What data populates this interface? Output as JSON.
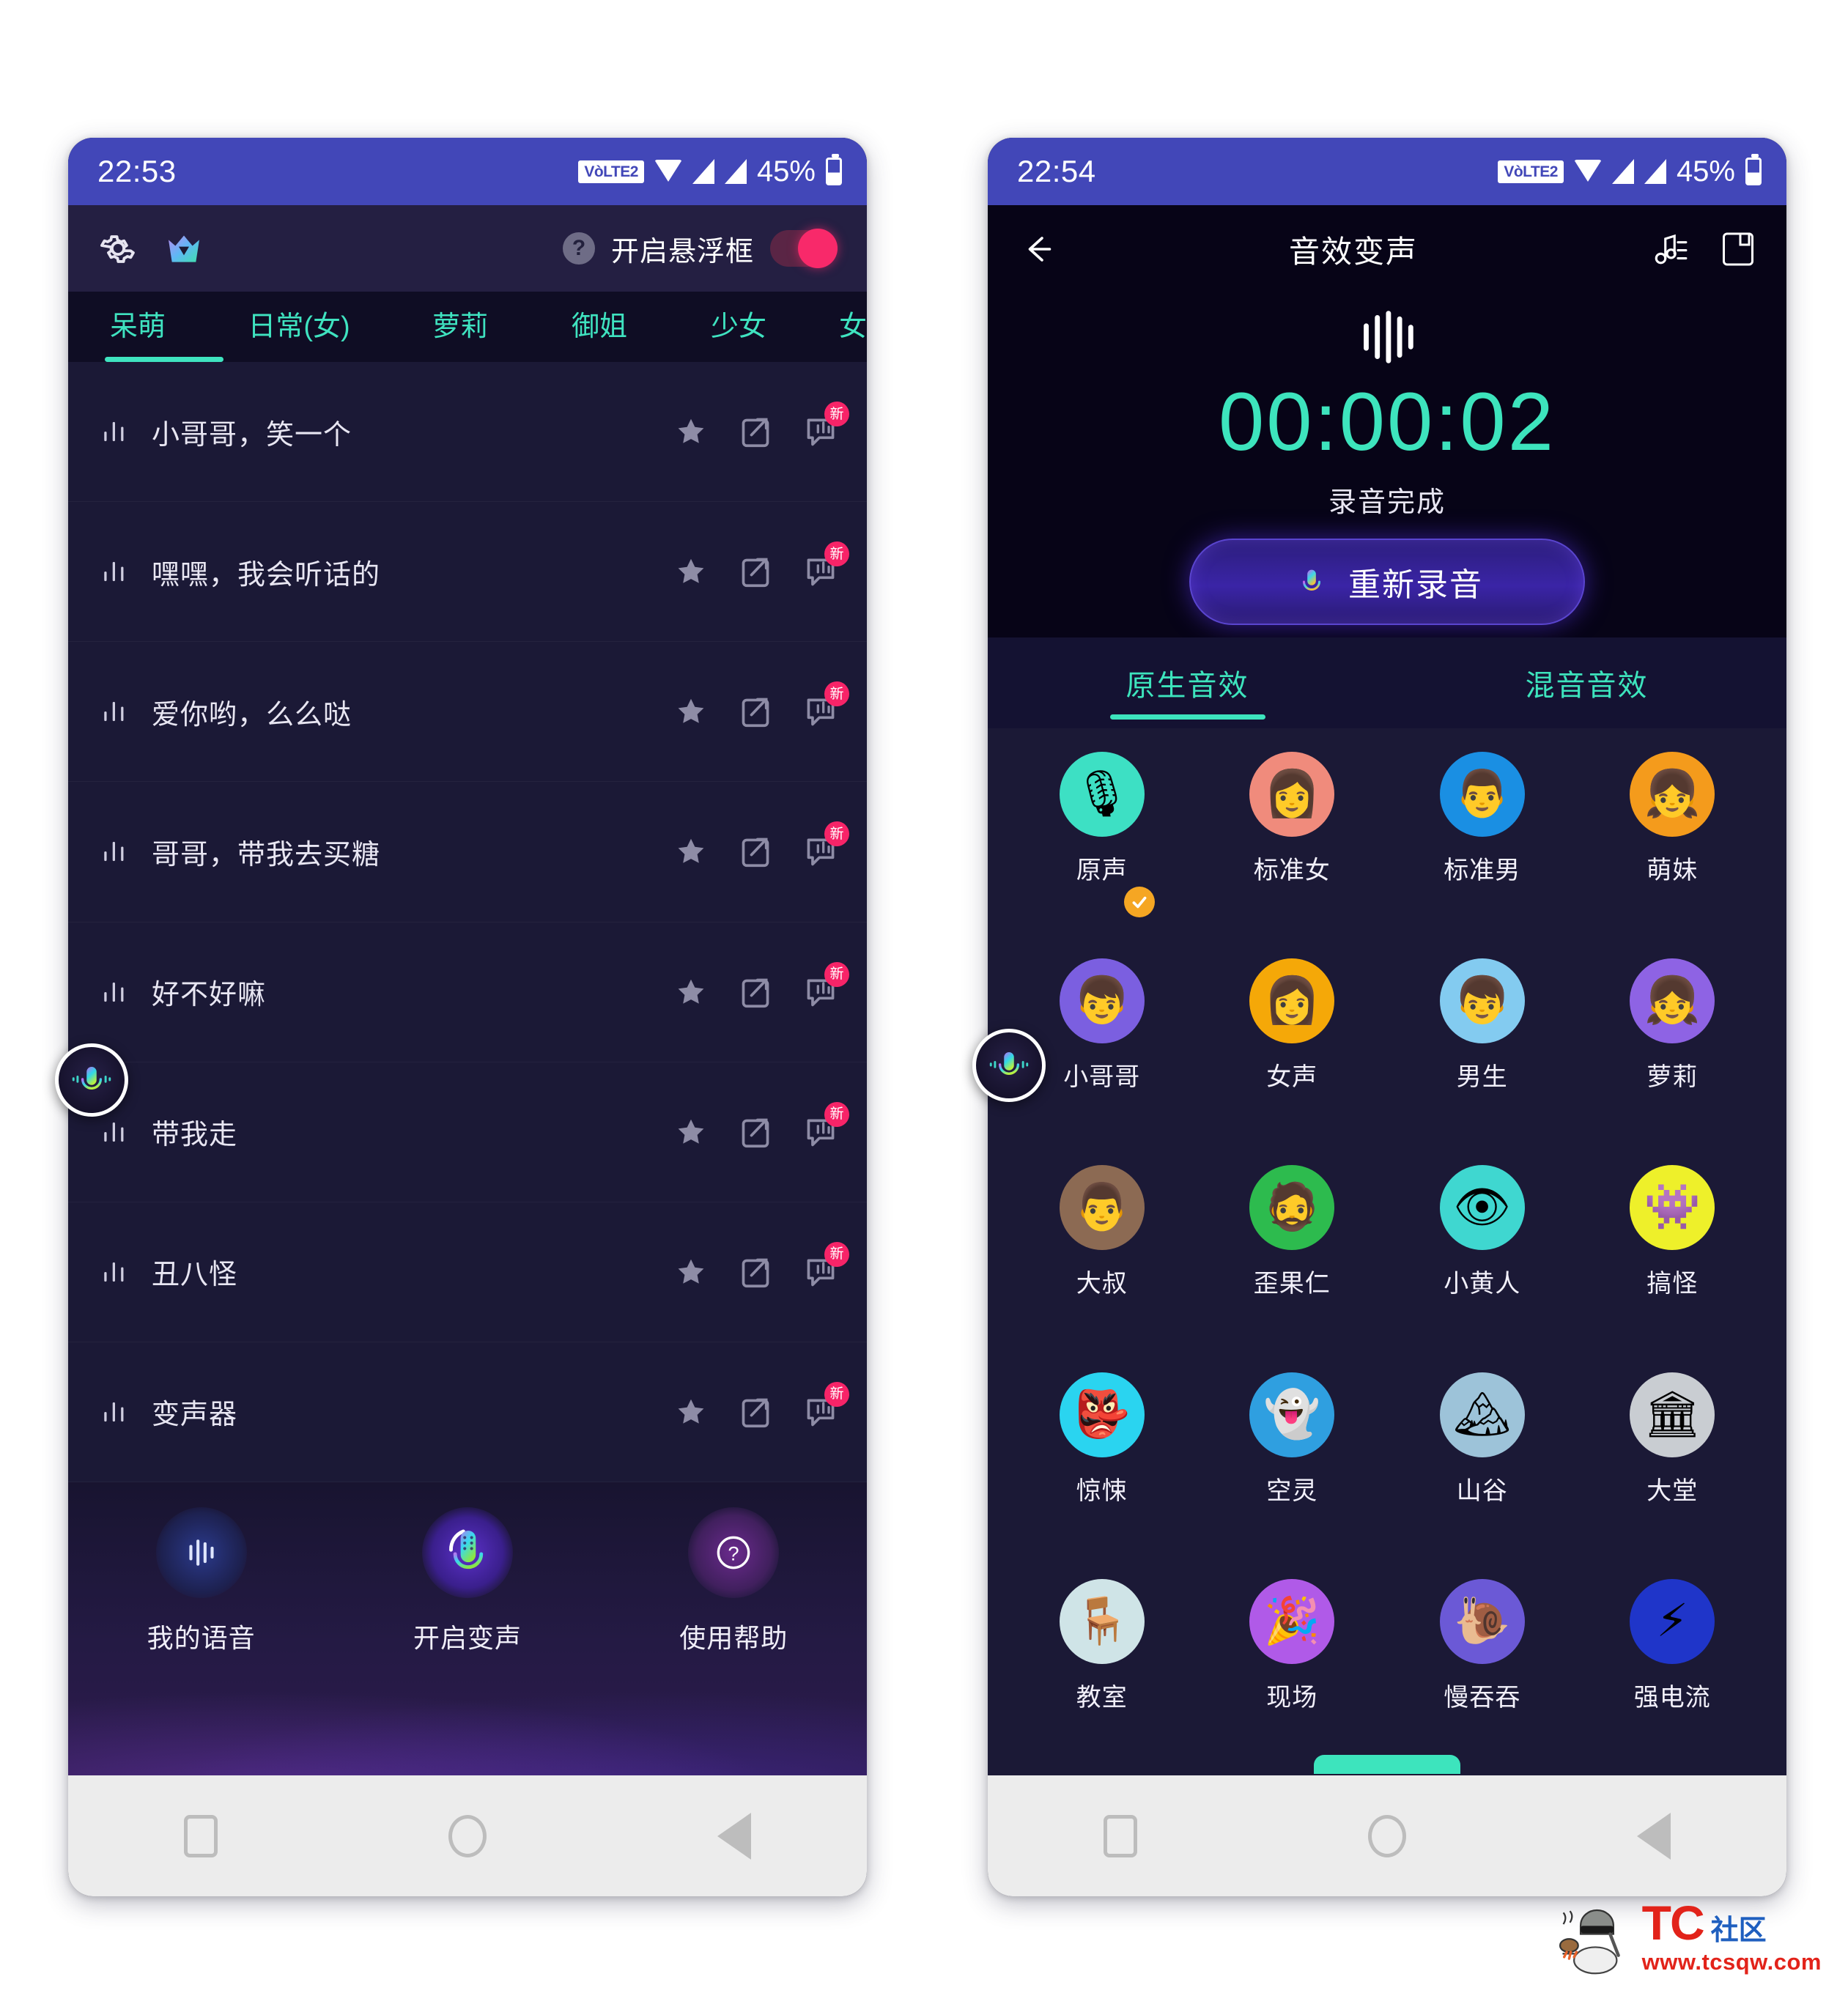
{
  "left_phone": {
    "status_bar": {
      "time": "22:53",
      "volte": "VòLTE2",
      "battery_percent": "45%",
      "icons": [
        "wifi-icon",
        "signal-icon",
        "signal-icon",
        "battery-icon"
      ]
    },
    "topbar": {
      "settings_icon": "gear-icon",
      "logo_icon": "crown-logo-icon",
      "help_icon": "question-mark-icon",
      "floating_label": "开启悬浮框",
      "toggle_on": true,
      "toggle_color": "#f8296a"
    },
    "tabs": {
      "active_index": 0,
      "accent": "#3fe3c0",
      "items": [
        {
          "label": "呆萌"
        },
        {
          "label": "日常(女)"
        },
        {
          "label": "萝莉"
        },
        {
          "label": "御姐"
        },
        {
          "label": "少女"
        },
        {
          "label": "女友"
        }
      ]
    },
    "voice_list": {
      "badge_text": "新",
      "badge_color": "#f72468",
      "items": [
        {
          "label": "小哥哥，笑一个"
        },
        {
          "label": "嘿嘿，我会听话的"
        },
        {
          "label": "爱你哟，么么哒"
        },
        {
          "label": "哥哥，带我去买糖"
        },
        {
          "label": "好不好嘛"
        },
        {
          "label": "带我走"
        },
        {
          "label": "丑八怪"
        },
        {
          "label": "变声器"
        }
      ]
    },
    "bottom_nav": [
      {
        "label": "我的语音",
        "icon": "waveform-icon"
      },
      {
        "label": "开启变声",
        "icon": "microphone-icon"
      },
      {
        "label": "使用帮助",
        "icon": "question-circle-icon"
      }
    ],
    "nav_bar": [
      "recents-square-icon",
      "home-circle-icon",
      "back-triangle-icon"
    ]
  },
  "right_phone": {
    "status_bar": {
      "time": "22:54",
      "volte": "VòLTE2",
      "battery_percent": "45%"
    },
    "appbar": {
      "back_icon": "back-arrow-icon",
      "title": "音效变声",
      "music_icon": "music-note-icon",
      "save_icon": "save-icon"
    },
    "recorder": {
      "wave_icon": "waveform-icon",
      "timer": "00:00:02",
      "timer_color": "#3de4bd",
      "status": "录音完成",
      "button_label": "重新录音",
      "button_icon": "microphone-icon"
    },
    "fx_tabs": {
      "active_index": 0,
      "accent": "#3de4bd",
      "items": [
        {
          "label": "原生音效"
        },
        {
          "label": "混音音效"
        }
      ]
    },
    "fx_grid": {
      "selected_index": 0,
      "check_color": "#f5a623",
      "items": [
        {
          "label": "原声",
          "glyph": "🎙",
          "bg": "#3de0c4",
          "selected": true
        },
        {
          "label": "标准女",
          "glyph": "👩",
          "bg": "#f08b7c",
          "selected": false
        },
        {
          "label": "标准男",
          "glyph": "👨",
          "bg": "#1a8fe3",
          "selected": false
        },
        {
          "label": "萌妹",
          "glyph": "👧",
          "bg": "#f49b1c",
          "selected": false
        },
        {
          "label": "小哥哥",
          "glyph": "👦",
          "bg": "#7b5fe0",
          "selected": false
        },
        {
          "label": "女声",
          "glyph": "👩",
          "bg": "#f5a808",
          "selected": false
        },
        {
          "label": "男生",
          "glyph": "👦",
          "bg": "#83cbf0",
          "selected": false
        },
        {
          "label": "萝莉",
          "glyph": "👧",
          "bg": "#8e63e4",
          "selected": false
        },
        {
          "label": "大叔",
          "glyph": "👨",
          "bg": "#8c6a53",
          "selected": false
        },
        {
          "label": "歪果仁",
          "glyph": "🧔",
          "bg": "#2dbb4e",
          "selected": false
        },
        {
          "label": "小黄人",
          "glyph": "👁",
          "bg": "#3fd7d0",
          "selected": false
        },
        {
          "label": "搞怪",
          "glyph": "👾",
          "bg": "#eef02a",
          "selected": false
        },
        {
          "label": "惊悚",
          "glyph": "👺",
          "bg": "#2ad4f0",
          "selected": false
        },
        {
          "label": "空灵",
          "glyph": "👻",
          "bg": "#2f9fe0",
          "selected": false
        },
        {
          "label": "山谷",
          "glyph": "🏔",
          "bg": "#9dc3d9",
          "selected": false
        },
        {
          "label": "大堂",
          "glyph": "🏛",
          "bg": "#c9cdd2",
          "selected": false
        },
        {
          "label": "教室",
          "glyph": "🪑",
          "bg": "#cfe4e7",
          "selected": false
        },
        {
          "label": "现场",
          "glyph": "🎉",
          "bg": "#b05ae8",
          "selected": false
        },
        {
          "label": "慢吞吞",
          "glyph": "🐌",
          "bg": "#6b59d6",
          "selected": false
        },
        {
          "label": "强电流",
          "glyph": "⚡",
          "bg": "#1f35c9",
          "selected": false
        }
      ]
    },
    "nav_bar": [
      "recents-square-icon",
      "home-circle-icon",
      "back-triangle-icon"
    ]
  },
  "watermark": {
    "brand": "TC",
    "brand_cn": "社区",
    "url": "www.tcsqw.com",
    "brand_color": "#e2231a",
    "cn_color": "#1f5fbf"
  }
}
